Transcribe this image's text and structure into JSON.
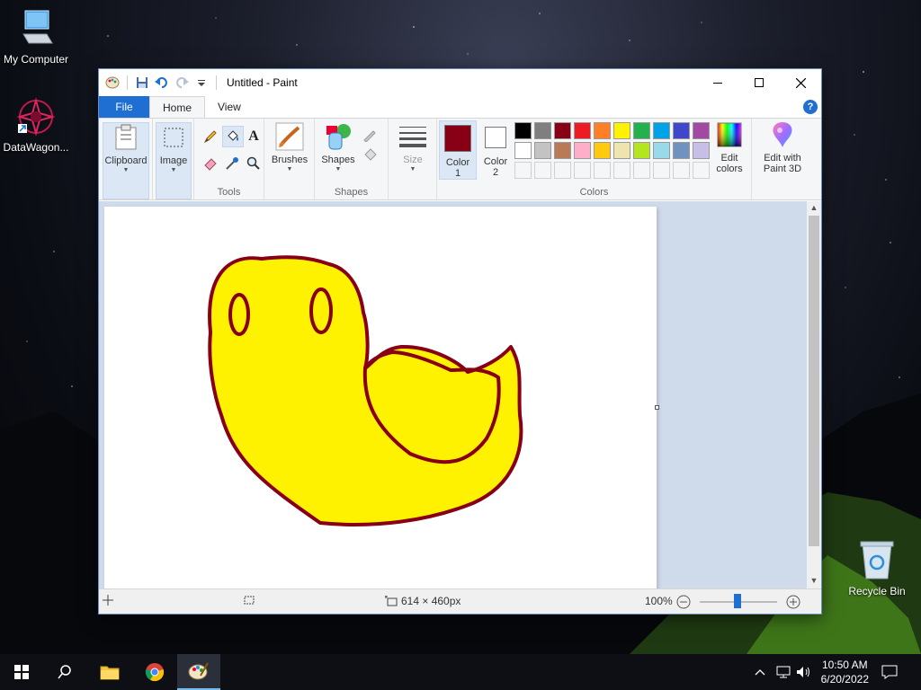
{
  "desktop": {
    "icons": [
      {
        "label": "My Computer"
      },
      {
        "label": "DataWagon..."
      },
      {
        "label": "Recycle Bin"
      }
    ]
  },
  "window": {
    "title": "Untitled - Paint",
    "tabs": {
      "file": "File",
      "home": "Home",
      "view": "View"
    },
    "help_label": "?"
  },
  "ribbon": {
    "clipboard": "Clipboard",
    "image": "Image",
    "tools_group": "Tools",
    "brushes": "Brushes",
    "shapes": "Shapes",
    "shapes_group": "Shapes",
    "size": "Size",
    "color1_line1": "Color",
    "color1_line2": "1",
    "color2_line1": "Color",
    "color2_line2": "2",
    "colors_group": "Colors",
    "edit_colors_line1": "Edit",
    "edit_colors_line2": "colors",
    "paint3d_line1": "Edit with",
    "paint3d_line2": "Paint 3D"
  },
  "colors": {
    "color1": "#880015",
    "color2": "#ffffff",
    "palette_row1": [
      "#000000",
      "#7f7f7f",
      "#880015",
      "#ed1c24",
      "#ff7f27",
      "#fff200",
      "#22b14c",
      "#00a2e8",
      "#3f48cc",
      "#a349a4"
    ],
    "palette_row2": [
      "#ffffff",
      "#c3c3c3",
      "#b97a57",
      "#ffaec9",
      "#ffc90e",
      "#efe4b0",
      "#b5e61d",
      "#99d9ea",
      "#7092be",
      "#c8bfe7"
    ]
  },
  "drawing": {
    "fill_color": "#fff200",
    "outline_color": "#880015"
  },
  "status": {
    "dimensions": "614 × 460px",
    "zoom": "100%"
  },
  "taskbar": {
    "time": "10:50 AM",
    "date": "6/20/2022"
  }
}
